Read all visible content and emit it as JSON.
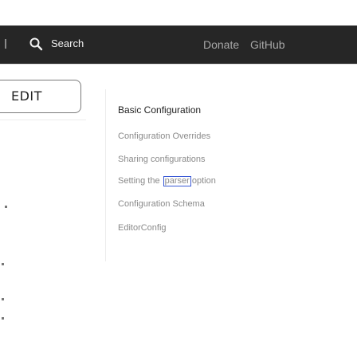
{
  "nav": {
    "search_label": "Search",
    "search_icon": "search-icon",
    "links": [
      "Donate",
      "GitHub"
    ]
  },
  "edit_button": {
    "label": "EDIT"
  },
  "docs": {
    "title": "Basic Configuration",
    "items": [
      "Configuration Overrides",
      "Sharing configurations",
      "Configuration Schema",
      "EditorConfig"
    ],
    "setting_item": {
      "before": "Setting the",
      "highlight": "parser",
      "after": "option"
    }
  },
  "colors": {
    "navbar_bg": "#262626",
    "highlight_border": "#3a59d6"
  }
}
